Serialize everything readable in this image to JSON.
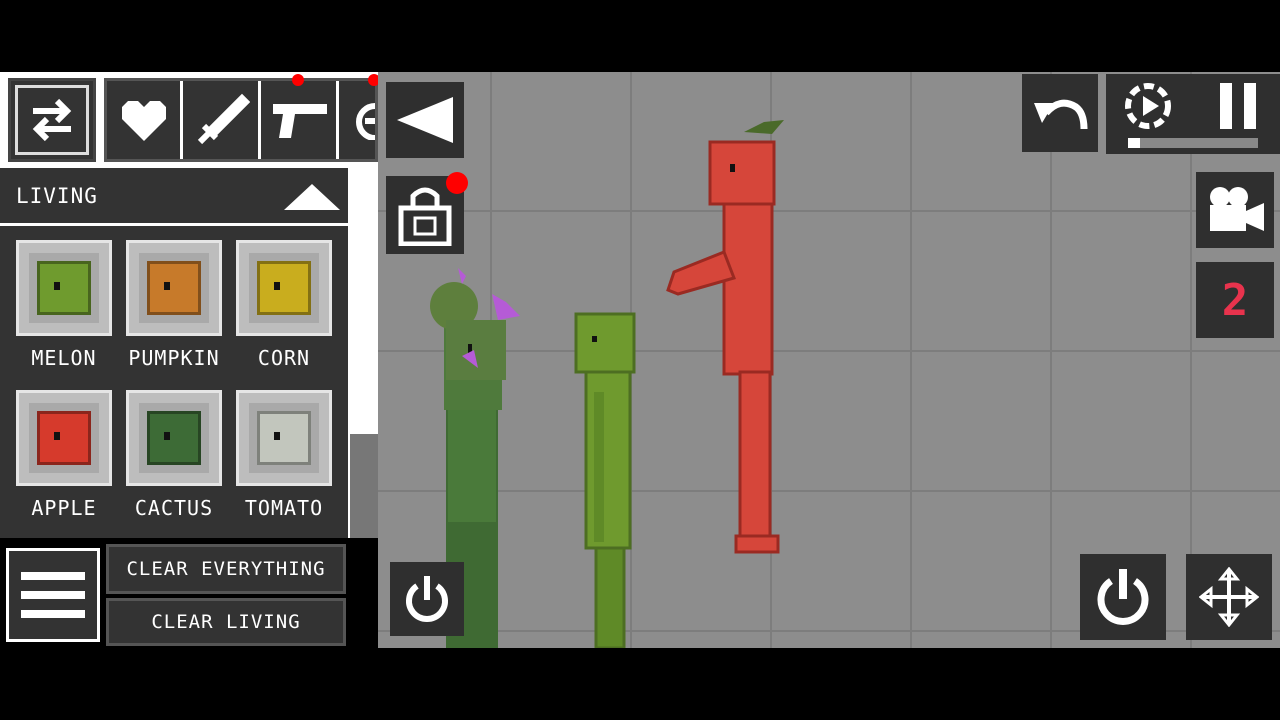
{
  "category": {
    "title": "LIVING"
  },
  "items": [
    {
      "label": "MELON",
      "color": "#6f9b2e"
    },
    {
      "label": "PUMPKIN",
      "color": "#c77a2a"
    },
    {
      "label": "CORN",
      "color": "#c9ad1e"
    },
    {
      "label": "APPLE",
      "color": "#d63a2c"
    },
    {
      "label": "CACTUS",
      "color": "#3d6b36"
    },
    {
      "label": "TOMATO",
      "color": "#c2c6bd"
    }
  ],
  "buttons": {
    "clear_everything": "CLEAR EVERYTHING",
    "clear_living": "CLEAR LIVING"
  },
  "camera_count": "2",
  "colors": {
    "panel_bg": "#333333",
    "stage_bg": "#8d8d8d",
    "count_color": "#e8334d",
    "notification": "#ff0000"
  },
  "icons": [
    "swap-icon",
    "heart-icon",
    "sword-icon",
    "gun-icon",
    "bomb-icon",
    "collapse-icon",
    "back-triangle-icon",
    "lock-icon",
    "undo-icon",
    "slowmo-icon",
    "pause-icon",
    "camera-icon",
    "power-icon",
    "move-icon",
    "menu-icon"
  ]
}
